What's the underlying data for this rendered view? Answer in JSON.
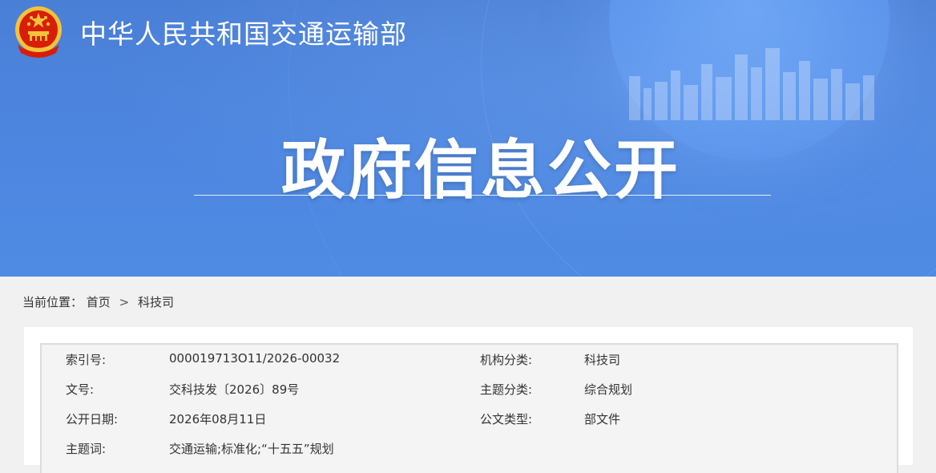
{
  "header": {
    "site_title": "中华人民共和国交通运输部",
    "hero_title": "政府信息公开",
    "emblem_icon": "national-emblem-icon",
    "colors": {
      "banner": "#4d86e0",
      "emblem_red": "#d81e06",
      "emblem_gold": "#f3c33b"
    }
  },
  "breadcrumb": {
    "prefix": "当前位置：",
    "home": "首页",
    "separator": ">",
    "current": "科技司"
  },
  "info": {
    "rows": [
      {
        "label1": "索引号:",
        "value1": "000019713O11/2026-00032",
        "label2": "机构分类:",
        "value2": "科技司"
      },
      {
        "label1": "文号:",
        "value1": "交科技发〔2026〕89号",
        "label2": "主题分类:",
        "value2": "综合规划"
      },
      {
        "label1": "公开日期:",
        "value1": "2026年08月11日",
        "label2": "公文类型:",
        "value2": "部文件"
      },
      {
        "label1": "主题词:",
        "value1": "交通运输;标准化;“十五五”规划",
        "label2": "",
        "value2": ""
      }
    ]
  }
}
